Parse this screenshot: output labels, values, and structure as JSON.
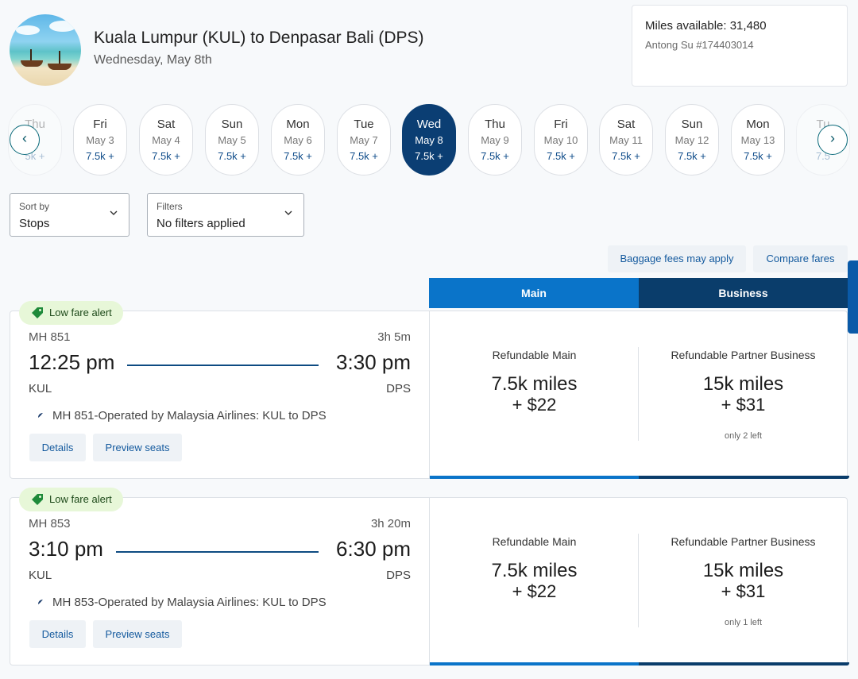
{
  "header": {
    "title": "Kuala Lumpur (KUL) to Denpasar Bali (DPS)",
    "date": "Wednesday, May 8th"
  },
  "account": {
    "miles": "Miles available: 31,480",
    "member": "Antong Su #174403014"
  },
  "dates": [
    {
      "day": "Thu",
      "date": "2",
      "price": "5k +"
    },
    {
      "day": "Fri",
      "date": "May 3",
      "price": "7.5k +"
    },
    {
      "day": "Sat",
      "date": "May 4",
      "price": "7.5k +"
    },
    {
      "day": "Sun",
      "date": "May 5",
      "price": "7.5k +"
    },
    {
      "day": "Mon",
      "date": "May 6",
      "price": "7.5k +"
    },
    {
      "day": "Tue",
      "date": "May 7",
      "price": "7.5k +"
    },
    {
      "day": "Wed",
      "date": "May 8",
      "price": "7.5k +"
    },
    {
      "day": "Thu",
      "date": "May 9",
      "price": "7.5k +"
    },
    {
      "day": "Fri",
      "date": "May 10",
      "price": "7.5k +"
    },
    {
      "day": "Sat",
      "date": "May 11",
      "price": "7.5k +"
    },
    {
      "day": "Sun",
      "date": "May 12",
      "price": "7.5k +"
    },
    {
      "day": "Mon",
      "date": "May 13",
      "price": "7.5k +"
    },
    {
      "day": "Tu",
      "date": "M",
      "price": "7.5"
    }
  ],
  "sort": {
    "label": "Sort by",
    "value": "Stops"
  },
  "filters": {
    "label": "Filters",
    "value": "No filters applied"
  },
  "links": {
    "baggage": "Baggage fees may apply",
    "compare": "Compare fares"
  },
  "tabs": {
    "main": "Main",
    "business": "Business"
  },
  "flights": [
    {
      "alert": "Low fare alert",
      "number": "MH 851",
      "duration": "3h 5m",
      "depart": "12:25 pm",
      "arrive": "3:30 pm",
      "from": "KUL",
      "to": "DPS",
      "operator": "MH 851-Operated by Malaysia Airlines: KUL to DPS",
      "details": "Details",
      "seats": "Preview seats",
      "main": {
        "name": "Refundable Main",
        "miles": "7.5k miles",
        "cash": "+ $22"
      },
      "business": {
        "name": "Refundable Partner Business",
        "miles": "15k miles",
        "cash": "+ $31",
        "left": "only 2 left"
      }
    },
    {
      "alert": "Low fare alert",
      "number": "MH 853",
      "duration": "3h 20m",
      "depart": "3:10 pm",
      "arrive": "6:30 pm",
      "from": "KUL",
      "to": "DPS",
      "operator": "MH 853-Operated by Malaysia Airlines: KUL to DPS",
      "details": "Details",
      "seats": "Preview seats",
      "main": {
        "name": "Refundable Main",
        "miles": "7.5k miles",
        "cash": "+ $22"
      },
      "business": {
        "name": "Refundable Partner Business",
        "miles": "15k miles",
        "cash": "+ $31",
        "left": "only 1 left"
      }
    }
  ]
}
